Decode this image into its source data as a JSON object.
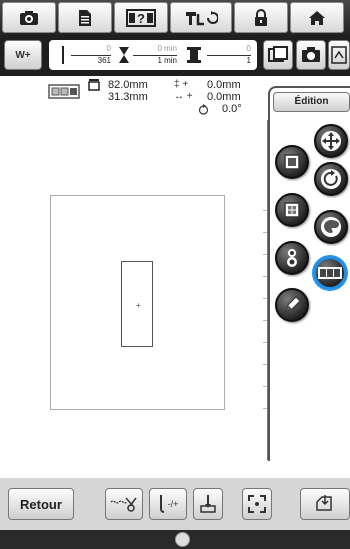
{
  "top_toolbar": {
    "icons": [
      "camera-icon",
      "document-icon",
      "help-icon",
      "sewing-icon",
      "lock-icon",
      "home-icon"
    ]
  },
  "counter": {
    "mode_label": "W+",
    "stitch_current": "0",
    "stitch_total": "361",
    "time_current": "0 min",
    "time_total": "1 min",
    "color_current": "0",
    "color_total": "1"
  },
  "info": {
    "width": "82.0mm",
    "height": "31.3mm",
    "v_offset_sym": "‡ +",
    "h_offset_sym": "↔ +",
    "v_offset": "0.0mm",
    "h_offset": "0.0mm",
    "angle": "0.0°"
  },
  "edit_panel": {
    "tab_label": "Édition",
    "buttons": [
      "move-icon",
      "rotate-icon",
      "border-icon",
      "density-icon",
      "color-icon",
      "array-icon",
      "stitch-icon",
      "pencil-icon"
    ]
  },
  "bottom": {
    "back_label": "Retour"
  },
  "colors": {
    "highlight": "#1e8fe8",
    "toolbar_dark": "#222222"
  }
}
